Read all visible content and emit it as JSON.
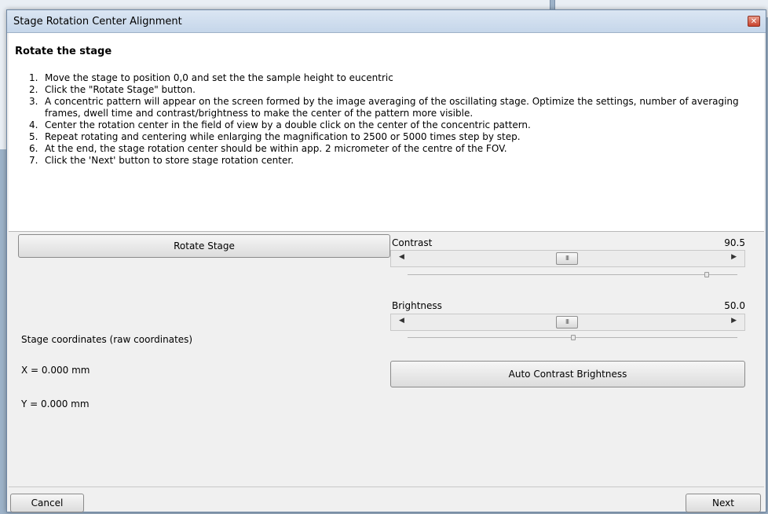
{
  "dialog": {
    "title": "Stage Rotation Center Alignment",
    "close_icon": "close-icon"
  },
  "instructions": {
    "heading": "Rotate the stage",
    "steps": [
      "Move the stage to position 0,0 and set the the sample height to eucentric",
      "Click the \"Rotate Stage\" button.",
      "A concentric pattern will appear on the screen formed by the image averaging of the oscillating stage. Optimize the settings, number of averaging frames, dwell time and contrast/brightness to make the center of the pattern more visible.",
      "Center the rotation center in the field of view by a double click on the center of the concentric pattern.",
      "Repeat rotating and centering while enlarging the magnification to 2500 or 5000 times step by step.",
      "At the end, the stage rotation center should be within app. 2 micrometer of the centre of the FOV.",
      "Click the 'Next' button to store stage rotation center."
    ],
    "step_numbers": [
      "1.",
      "2.",
      "3.",
      "4.",
      "5.",
      "6.",
      "7."
    ]
  },
  "controls": {
    "rotate_button": "Rotate Stage",
    "contrast_label": "Contrast",
    "contrast_value": "90.5",
    "contrast_level": 0.905,
    "brightness_label": "Brightness",
    "brightness_value": "50.0",
    "brightness_level": 0.5,
    "auto_button": "Auto Contrast Brightness",
    "thumb_glyph": "III",
    "left_arrow": "◀",
    "right_arrow": "▶"
  },
  "coordinates": {
    "heading": "Stage coordinates (raw coordinates)",
    "x": "X = 0.000 mm",
    "y": "Y = 0.000 mm"
  },
  "footer": {
    "cancel": "Cancel",
    "next": "Next"
  }
}
